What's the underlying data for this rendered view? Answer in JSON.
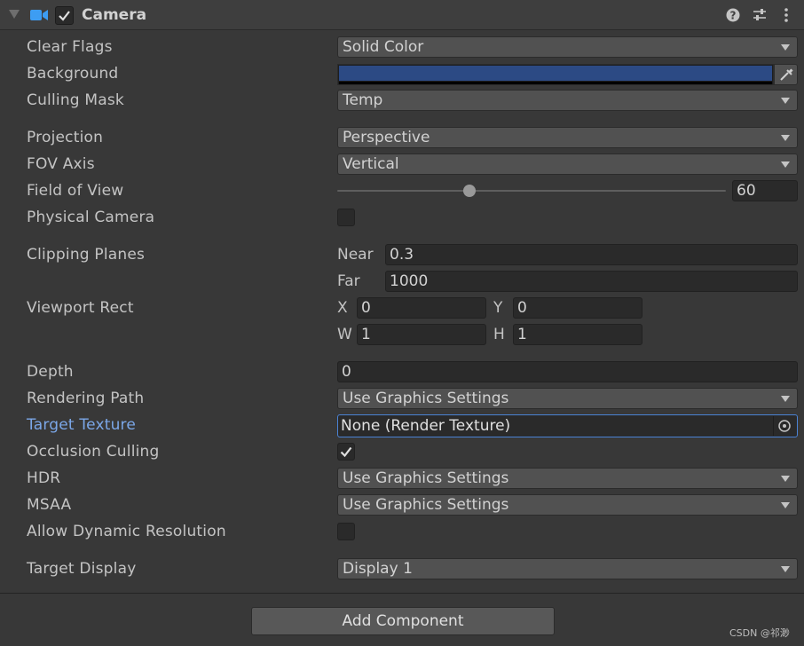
{
  "component": {
    "title": "Camera",
    "enabled": true
  },
  "props": {
    "clear_flags": {
      "label": "Clear Flags",
      "value": "Solid Color"
    },
    "background": {
      "label": "Background",
      "color": "#2c4a84"
    },
    "culling_mask": {
      "label": "Culling Mask",
      "value": "Temp"
    },
    "projection": {
      "label": "Projection",
      "value": "Perspective"
    },
    "fov_axis": {
      "label": "FOV Axis",
      "value": "Vertical"
    },
    "field_of_view": {
      "label": "Field of View",
      "value": "60"
    },
    "physical_camera": {
      "label": "Physical Camera",
      "checked": false
    },
    "clipping_planes": {
      "label": "Clipping Planes",
      "near_label": "Near",
      "near": "0.3",
      "far_label": "Far",
      "far": "1000"
    },
    "viewport_rect": {
      "label": "Viewport Rect",
      "x_label": "X",
      "x": "0",
      "y_label": "Y",
      "y": "0",
      "w_label": "W",
      "w": "1",
      "h_label": "H",
      "h": "1"
    },
    "depth": {
      "label": "Depth",
      "value": "0"
    },
    "rendering_path": {
      "label": "Rendering Path",
      "value": "Use Graphics Settings"
    },
    "target_texture": {
      "label": "Target Texture",
      "value": "None (Render Texture)"
    },
    "occlusion_culling": {
      "label": "Occlusion Culling",
      "checked": true
    },
    "hdr": {
      "label": "HDR",
      "value": "Use Graphics Settings"
    },
    "msaa": {
      "label": "MSAA",
      "value": "Use Graphics Settings"
    },
    "allow_dynamic_resolution": {
      "label": "Allow Dynamic Resolution",
      "checked": false
    },
    "target_display": {
      "label": "Target Display",
      "value": "Display 1"
    }
  },
  "add_component_label": "Add Component",
  "watermark": "CSDN @祁渺",
  "colors": {
    "accent": "#7ba7e8",
    "focus_border": "#4a82d4",
    "camera_icon": "#3d9df3"
  }
}
